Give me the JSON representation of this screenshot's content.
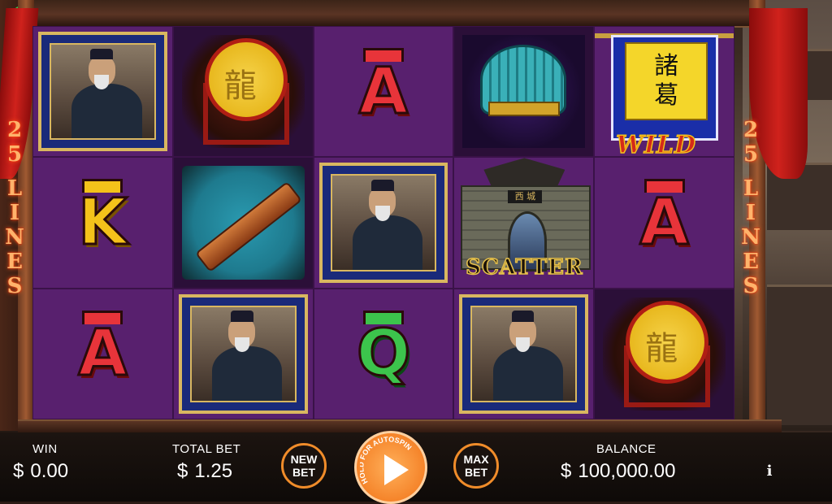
{
  "reels": {
    "lines_left": [
      "2",
      "5",
      "L",
      "I",
      "N",
      "E",
      "S"
    ],
    "lines_right": [
      "2",
      "5",
      "L",
      "I",
      "N",
      "E",
      "S"
    ],
    "symbols": [
      [
        "strategist",
        "A",
        "strategist",
        "scatter",
        "wild"
      ],
      [
        "drum",
        "zither",
        "A",
        "scatter-lower",
        "A"
      ],
      [
        "K",
        "strategist",
        "Q",
        "strategist",
        "drum"
      ]
    ],
    "letters": {
      "r0c2": "A",
      "r1c4": "A",
      "r1c0": "K",
      "r2c0": "A",
      "r2c2": "Q"
    },
    "wild": {
      "banner_glyph_1": "諸",
      "banner_glyph_2": "葛",
      "label": "WILD"
    },
    "scatter": {
      "label": "SCATTER",
      "sign": "西 城"
    }
  },
  "hud": {
    "win_label": "WIN",
    "win_currency": "$",
    "win_value": "0.00",
    "total_bet_label": "TOTAL BET",
    "total_bet_currency": "$",
    "total_bet_value": "1.25",
    "new_bet_line1": "NEW",
    "new_bet_line2": "BET",
    "spin_hint": "HOLD FOR AUTOSPIN",
    "max_bet_line1": "MAX",
    "max_bet_line2": "BET",
    "balance_label": "BALANCE",
    "balance_currency": "$",
    "balance_value": "100,000.00",
    "info_label": "i"
  },
  "colors": {
    "accent": "#f08c2a",
    "reel_bg": "#58206e",
    "frame": "#5a3424"
  }
}
